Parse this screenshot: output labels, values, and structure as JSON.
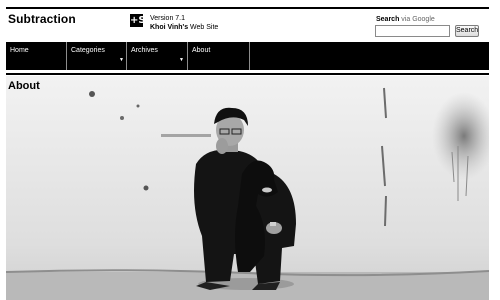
{
  "site": {
    "title": "Subtraction",
    "logo_glyph": "+S",
    "version": "Version 7.1",
    "byline_owner": "Khoi Vinh's",
    "byline_rest": " Web Site"
  },
  "search": {
    "label_strong": "Search",
    "label_muted": " via Google",
    "input_value": "",
    "button_label": "Search"
  },
  "nav": {
    "items": [
      {
        "label": "Home",
        "has_dropdown": false
      },
      {
        "label": "Categories",
        "has_dropdown": true
      },
      {
        "label": "Archives",
        "has_dropdown": true
      },
      {
        "label": "About",
        "has_dropdown": false
      }
    ],
    "caret_glyph": "▼"
  },
  "main": {
    "heading": "About"
  },
  "colors": {
    "nav_background": "#000000",
    "nav_text": "#ffffff",
    "page_background": "#ffffff"
  }
}
